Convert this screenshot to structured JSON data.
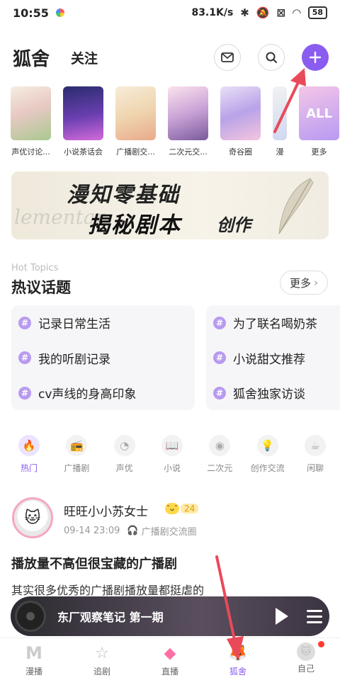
{
  "status_bar": {
    "time": "10:55",
    "net_speed": "83.1K/s",
    "battery": "58"
  },
  "header": {
    "tab_main": "狐舍",
    "tab_follow": "关注",
    "icons": [
      "mail-icon",
      "search-icon",
      "plus-icon"
    ]
  },
  "circles": [
    {
      "label": "声优讨论..."
    },
    {
      "label": "小说茶话会"
    },
    {
      "label": "广播剧交..."
    },
    {
      "label": "二次元交..."
    },
    {
      "label": "奇谷圈"
    },
    {
      "label": "漫"
    },
    {
      "label": "更多",
      "thumb_text": "ALL"
    }
  ],
  "banner": {
    "line1": "漫知零基础",
    "line2": "揭秘剧本",
    "line3": "创作",
    "ghost": "lementar"
  },
  "hot_topics": {
    "title_en": "Hot Topics",
    "title": "热议话题",
    "more": "更多",
    "left": [
      "记录日常生活",
      "我的听剧记录",
      "cv声线的身高印象"
    ],
    "right": [
      "为了联名喝奶茶",
      "小说甜文推荐",
      "狐舍独家访谈"
    ]
  },
  "categories": [
    {
      "label": "热门",
      "icon": "flame-icon",
      "active": true
    },
    {
      "label": "广播剧",
      "icon": "radio-icon"
    },
    {
      "label": "声优",
      "icon": "microphone-icon"
    },
    {
      "label": "小说",
      "icon": "book-icon"
    },
    {
      "label": "二次元",
      "icon": "pokeball-icon"
    },
    {
      "label": "创作交流",
      "icon": "lightbulb-icon"
    },
    {
      "label": "闲聊",
      "icon": "cup-icon"
    }
  ],
  "post": {
    "author": "旺旺小小苏女士",
    "level": "24",
    "time": "09-14 23:09",
    "circle": "广播剧交流圈",
    "title": "播放量不高但很宝藏的广播剧",
    "body": "其实很多优秀的广播剧播放量都挺虐的"
  },
  "player": {
    "title": "东厂观察笔记 第一期"
  },
  "bottom_nav": [
    {
      "label": "漫播",
      "icon": "manbo-logo-icon"
    },
    {
      "label": "追剧",
      "icon": "star-icon"
    },
    {
      "label": "直播",
      "icon": "gem-icon"
    },
    {
      "label": "狐舍",
      "icon": "fox-icon",
      "active": true
    },
    {
      "label": "自己",
      "icon": "profile-icon"
    }
  ],
  "colors": {
    "accent": "#8a5cf0",
    "annotation": "#e94a5a"
  }
}
